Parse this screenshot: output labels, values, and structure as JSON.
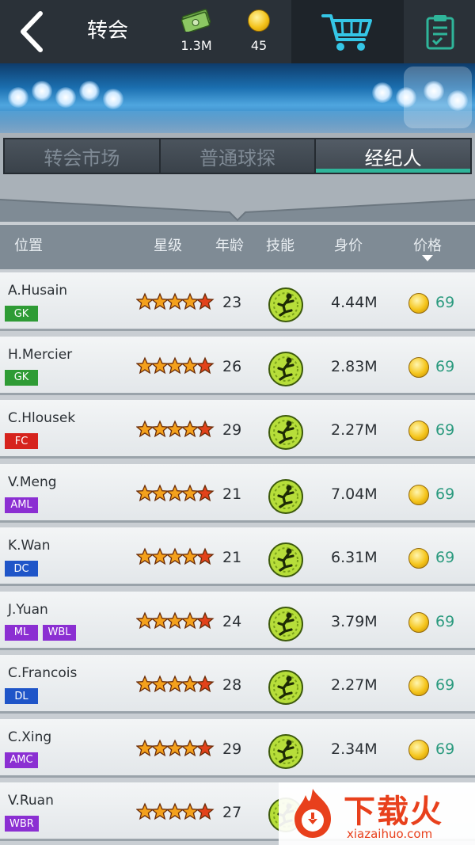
{
  "header": {
    "title": "转会",
    "cash": "1.3M",
    "coins": "45"
  },
  "tabs": [
    {
      "label": "转会市场",
      "active": false
    },
    {
      "label": "普通球探",
      "active": false
    },
    {
      "label": "经纪人",
      "active": true
    }
  ],
  "columns": {
    "position": "位置",
    "stars": "星级",
    "age": "年龄",
    "skill": "技能",
    "value": "身价",
    "price": "价格"
  },
  "badge_colors": {
    "GK": "#2e9b35",
    "FC": "#d6231d",
    "AML": "#8b2fd2",
    "AMC": "#8b2fd2",
    "ML": "#8b2fd2",
    "WBL": "#8b2fd2",
    "WBR": "#8b2fd2",
    "DC": "#1f55c8",
    "DL": "#1f55c8"
  },
  "players": [
    {
      "name": "A.Husain",
      "positions": [
        "GK"
      ],
      "stars": 5,
      "age": "23",
      "value": "4.44M",
      "price": "69"
    },
    {
      "name": "H.Mercier",
      "positions": [
        "GK"
      ],
      "stars": 5,
      "age": "26",
      "value": "2.83M",
      "price": "69"
    },
    {
      "name": "C.Hlousek",
      "positions": [
        "FC"
      ],
      "stars": 5,
      "age": "29",
      "value": "2.27M",
      "price": "69"
    },
    {
      "name": "V.Meng",
      "positions": [
        "AML"
      ],
      "stars": 5,
      "age": "21",
      "value": "7.04M",
      "price": "69"
    },
    {
      "name": "K.Wan",
      "positions": [
        "DC"
      ],
      "stars": 5,
      "age": "21",
      "value": "6.31M",
      "price": "69"
    },
    {
      "name": "J.Yuan",
      "positions": [
        "ML",
        "WBL"
      ],
      "stars": 5,
      "age": "24",
      "value": "3.79M",
      "price": "69"
    },
    {
      "name": "C.Francois",
      "positions": [
        "DL"
      ],
      "stars": 5,
      "age": "28",
      "value": "2.27M",
      "price": "69"
    },
    {
      "name": "C.Xing",
      "positions": [
        "AMC"
      ],
      "stars": 5,
      "age": "29",
      "value": "2.34M",
      "price": "69"
    },
    {
      "name": "V.Ruan",
      "positions": [
        "WBR"
      ],
      "stars": 5,
      "age": "27",
      "value": "",
      "price": ""
    }
  ],
  "watermark": {
    "text": "下载火",
    "url": "xiazaihuo.com"
  }
}
